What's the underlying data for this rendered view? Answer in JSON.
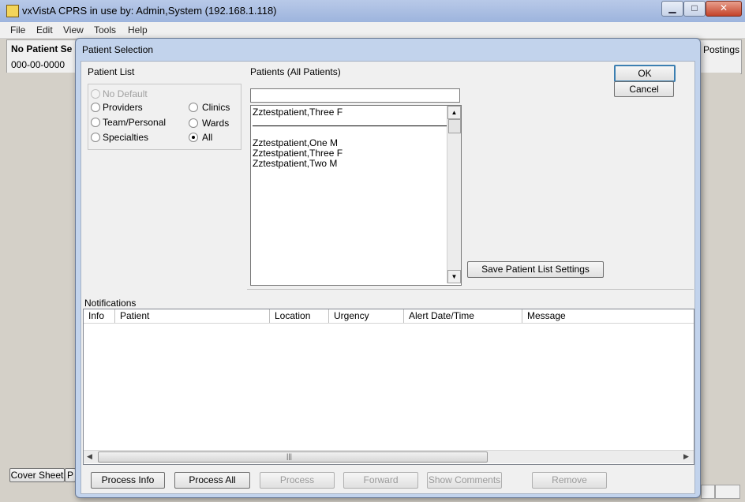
{
  "app": {
    "title": "vxVistA CPRS in use by: Admin,System  (192.168.1.118)",
    "menu": [
      "File",
      "Edit",
      "View",
      "Tools",
      "Help"
    ],
    "patient_name": "No Patient Se",
    "patient_ssn": "000-00-0000",
    "postings": "Postings",
    "tab_cover_sheet": "Cover Sheet",
    "tab_partial": "P"
  },
  "dialog": {
    "title": "Patient Selection",
    "ok_label": "OK",
    "cancel_label": "Cancel",
    "patient_list": {
      "heading": "Patient List",
      "options": [
        {
          "label": "No Default",
          "selected": false,
          "enabled": false
        },
        {
          "label": "Providers",
          "selected": false,
          "enabled": true
        },
        {
          "label": "Team/Personal",
          "selected": false,
          "enabled": true
        },
        {
          "label": "Specialties",
          "selected": false,
          "enabled": true
        },
        {
          "label": "Clinics",
          "selected": false,
          "enabled": true
        },
        {
          "label": "Wards",
          "selected": false,
          "enabled": true
        },
        {
          "label": "All",
          "selected": true,
          "enabled": true
        }
      ]
    },
    "patients": {
      "heading": "Patients (All Patients)",
      "search_value": "",
      "recent": "Zztestpatient,Three F",
      "items": [
        "Zztestpatient,One M",
        "Zztestpatient,Three F",
        "Zztestpatient,Two M"
      ]
    },
    "save_settings_label": "Save Patient List Settings",
    "notifications": {
      "heading": "Notifications",
      "columns": [
        "Info",
        "Patient",
        "Location",
        "Urgency",
        "Alert Date/Time",
        "Message"
      ],
      "rows": []
    },
    "buttons": {
      "process_info": "Process Info",
      "process_all": "Process All",
      "process": "Process",
      "forward": "Forward",
      "show_comments": "Show Comments",
      "remove": "Remove"
    }
  }
}
